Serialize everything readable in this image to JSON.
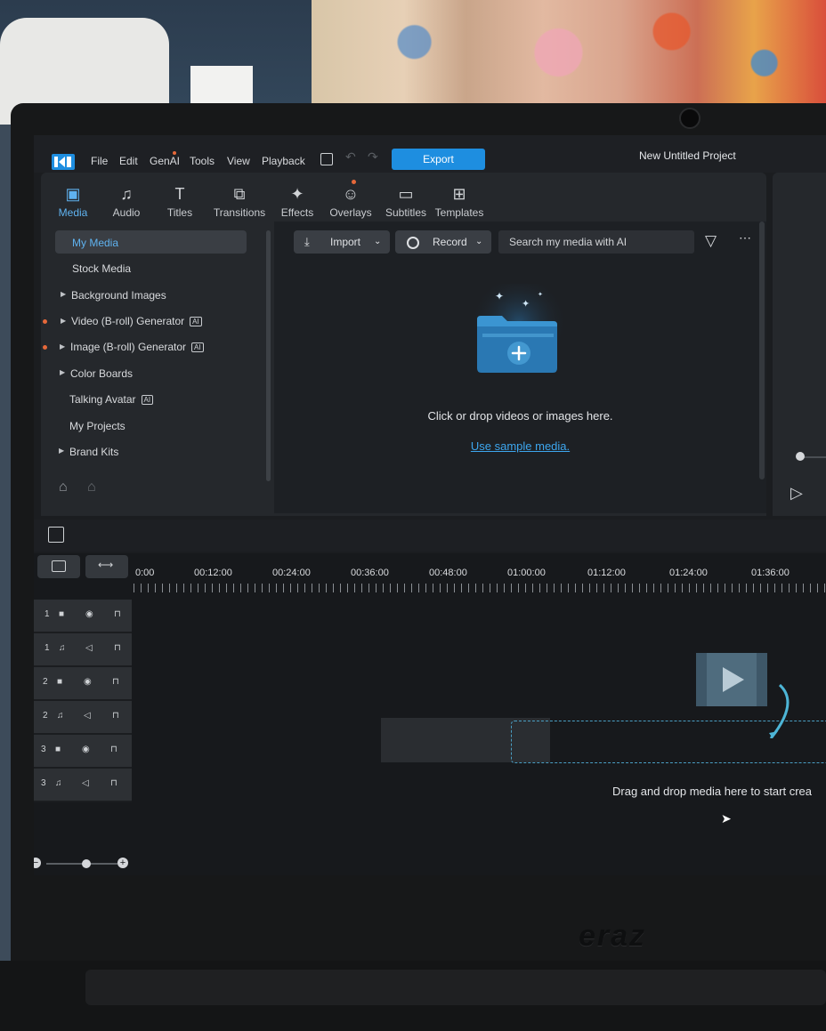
{
  "app": {
    "menu": [
      "File",
      "Edit",
      "GenAI",
      "Tools",
      "View",
      "Playback"
    ],
    "export_label": "Export",
    "project_title": "New Untitled Project"
  },
  "tabs": [
    {
      "label": "Media",
      "icon": "media-icon",
      "active": true
    },
    {
      "label": "Audio",
      "icon": "music-note-icon"
    },
    {
      "label": "Titles",
      "icon": "text-t-icon"
    },
    {
      "label": "Transitions",
      "icon": "transition-icon"
    },
    {
      "label": "Effects",
      "icon": "effects-icon"
    },
    {
      "label": "Overlays",
      "icon": "sticker-icon"
    },
    {
      "label": "Subtitles",
      "icon": "subtitles-icon"
    },
    {
      "label": "Templates",
      "icon": "templates-icon"
    }
  ],
  "sidebar": {
    "items": [
      {
        "label": "My Media",
        "active": true
      },
      {
        "label": "Stock Media"
      },
      {
        "label": "Background Images",
        "expandable": true
      },
      {
        "label": "Video (B-roll) Generator",
        "expandable": true,
        "ai": true,
        "new": true
      },
      {
        "label": "Image (B-roll) Generator",
        "expandable": true,
        "ai": true,
        "new": true
      },
      {
        "label": "Color Boards",
        "expandable": true
      },
      {
        "label": "Talking Avatar",
        "ai": true
      },
      {
        "label": "My Projects"
      },
      {
        "label": "Brand Kits",
        "expandable": true
      }
    ],
    "ai_badge": "AI"
  },
  "toolbar": {
    "import_label": "Import",
    "record_label": "Record",
    "search_placeholder": "Search my media with AI"
  },
  "library": {
    "drop_text": "Click or drop videos or images here.",
    "sample_link": "Use sample media."
  },
  "timeline": {
    "ruler": [
      "0:00",
      "00:12:00",
      "00:24:00",
      "00:36:00",
      "00:48:00",
      "01:00:00",
      "01:12:00",
      "01:24:00",
      "01:36:00"
    ],
    "tracks": [
      {
        "num": "1",
        "type": "video"
      },
      {
        "num": "1",
        "type": "audio"
      },
      {
        "num": "2",
        "type": "video"
      },
      {
        "num": "2",
        "type": "audio"
      },
      {
        "num": "3",
        "type": "video"
      },
      {
        "num": "3",
        "type": "audio"
      }
    ],
    "drag_text": "Drag and drop media here to start crea"
  },
  "colors": {
    "accent": "#1e8ee0",
    "active_tab": "#5fb2ef",
    "link": "#3da6ee",
    "new_dot": "#e6683a"
  }
}
